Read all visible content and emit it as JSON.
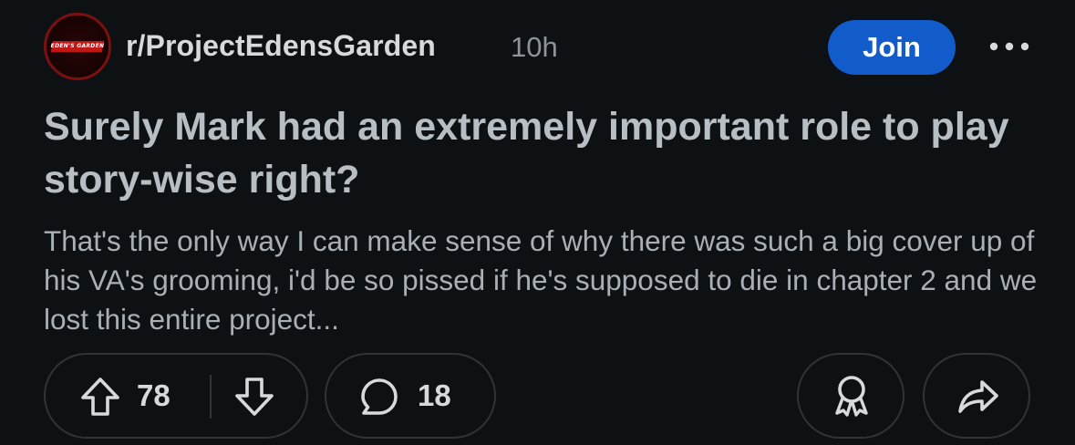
{
  "post": {
    "subreddit": "r/ProjectEdensGarden",
    "time": "10h",
    "join_label": "Join",
    "title": "Surely Mark had an extremely important role to play story-wise right?",
    "body": "That's the only way I can make sense of why there was such a big cover up of his VA's grooming, i'd be so pissed if he's supposed to die in chapter 2 and we lost this entire project...",
    "avatar_text": "EDEN'S GARDEN"
  },
  "actions": {
    "upvotes": "78",
    "comments": "18"
  },
  "colors": {
    "background": "#0e1113",
    "join_button": "#115bca",
    "pill_border": "#2e3438",
    "title_text": "#b7bec4",
    "body_text": "#a8b0b6",
    "meta_text": "#8c9499"
  },
  "icons": {
    "upvote": "arrow-up-icon",
    "downvote": "arrow-down-icon",
    "comment": "comment-bubble-icon",
    "award": "award-icon",
    "share": "share-arrow-icon",
    "more": "more-dots-icon"
  }
}
